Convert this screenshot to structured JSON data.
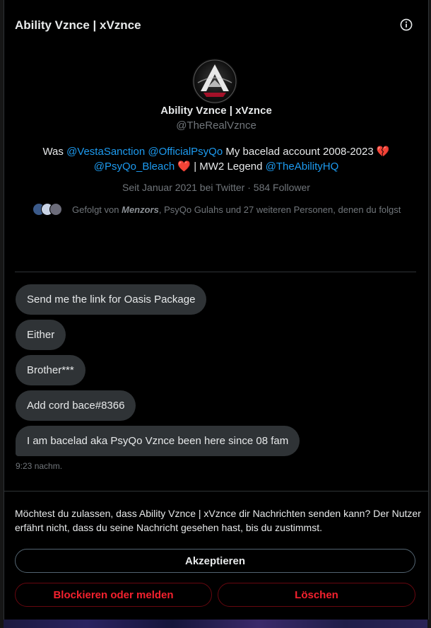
{
  "header": {
    "title": "Ability Vznce | xVznce",
    "info_icon": "info-icon"
  },
  "profile": {
    "name": "Ability Vznce | xVznce",
    "handle": "@TheRealVznce",
    "bio": {
      "was": "Was ",
      "mention1": "@VestaSanction",
      "mention2": "@OfficialPsyQo",
      "text1": " My bacelad account 2008-2023 ",
      "emoji_broken_heart": "💔",
      "mention3": "@PsyQo_Bleach",
      "emoji_heart": "❤️",
      "text2": " | MW2 Legend ",
      "mention4": "@TheAbilityHQ"
    },
    "joined": "Seit Januar 2021 bei Twitter",
    "separator": "·",
    "followers": "584 Follower",
    "followed_by_prefix": "Gefolgt von ",
    "followed_by_name": "Menzors",
    "followed_by_rest": ", PsyQo Gulahs und 27 weiteren Personen, denen du folgst"
  },
  "messages": [
    "Send me the link for Oasis Package",
    "Either",
    "Brother***",
    "Add cord bace#8366",
    "I am bacelad aka PsyQo Vznce been here since 08 fam"
  ],
  "message_time": "9:23 nachm.",
  "request": {
    "prompt": "Möchtest du zulassen, dass Ability Vznce | xVznce dir Nachrichten senden kann? Der Nutzer erfährt nicht, dass du seine Nachricht gesehen hast, bis du zustimmst.",
    "accept_label": "Akzeptieren",
    "block_label": "Blockieren oder melden",
    "delete_label": "Löschen"
  },
  "colors": {
    "accent": "#1d9bf0",
    "danger": "#f4212e",
    "bubble": "#2f3336",
    "muted": "#71767b"
  }
}
